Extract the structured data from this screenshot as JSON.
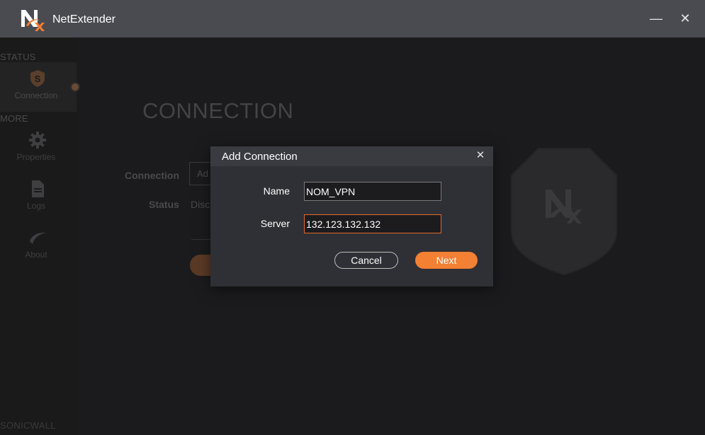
{
  "window": {
    "title": "NetExtender",
    "minimize_glyph": "—",
    "close_glyph": "✕"
  },
  "sidebar": {
    "section_status": "STATUS",
    "section_more": "MORE",
    "items": [
      {
        "label": "Connection",
        "icon": "connection-shield-icon"
      },
      {
        "label": "Properties",
        "icon": "gear-icon"
      },
      {
        "label": "Logs",
        "icon": "document-icon"
      },
      {
        "label": "About",
        "icon": "sonicwall-swoosh-icon"
      }
    ],
    "brand": "SONICWALL"
  },
  "main": {
    "title": "CONNECTION",
    "connection_label": "Connection",
    "connection_value": "Ad",
    "status_label": "Status",
    "status_value": "Disc"
  },
  "modal": {
    "title": "Add Connection",
    "close_glyph": "✕",
    "name_label": "Name",
    "name_value": "NOM_VPN",
    "server_label": "Server",
    "server_value": "132.123.132.132",
    "cancel_label": "Cancel",
    "next_label": "Next"
  },
  "colors": {
    "accent": "#f48033",
    "titlebar": "#4a4b50",
    "modal_bg": "#2f3035",
    "focus_border": "#e06b2a"
  }
}
